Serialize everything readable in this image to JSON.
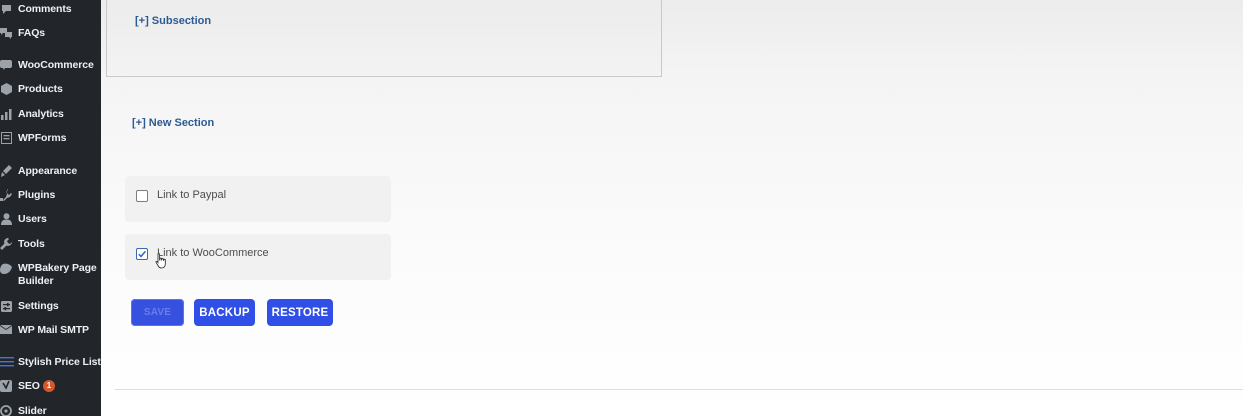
{
  "sidebar": {
    "items": [
      {
        "label": "Comments",
        "icon": "comment-icon"
      },
      {
        "label": "FAQs",
        "icon": "faq-icon"
      },
      {
        "label": "WooCommerce",
        "icon": "woocommerce-icon"
      },
      {
        "label": "Products",
        "icon": "products-icon"
      },
      {
        "label": "Analytics",
        "icon": "analytics-icon"
      },
      {
        "label": "WPForms",
        "icon": "wpforms-icon"
      },
      {
        "label": "Appearance",
        "icon": "appearance-icon"
      },
      {
        "label": "Plugins",
        "icon": "plugins-icon"
      },
      {
        "label": "Users",
        "icon": "users-icon"
      },
      {
        "label": "Tools",
        "icon": "tools-icon"
      },
      {
        "label": "WPBakery Page Builder",
        "icon": "wpbakery-icon"
      },
      {
        "label": "Settings",
        "icon": "settings-icon"
      },
      {
        "label": "WP Mail SMTP",
        "icon": "mail-icon"
      },
      {
        "label": "Stylish Price List",
        "icon": "price-list-icon"
      },
      {
        "label": "SEO",
        "icon": "yoast-icon",
        "badge": "1"
      },
      {
        "label": "Slider Revolution",
        "icon": "slider-icon"
      }
    ]
  },
  "main": {
    "add_subsection_label": "[+] Subsection",
    "add_section_label": "[+] New Section",
    "options": [
      {
        "label": "Link to Paypal",
        "checked": false
      },
      {
        "label": "Link to WooCommerce",
        "checked": true
      }
    ],
    "buttons": {
      "save": "SAVE",
      "backup": "BACKUP",
      "restore": "RESTORE"
    }
  },
  "colors": {
    "sidebar_bg": "#22262b",
    "button_bg": "#2f4fe6",
    "link": "#2b5a93",
    "badge": "#d6582a"
  }
}
